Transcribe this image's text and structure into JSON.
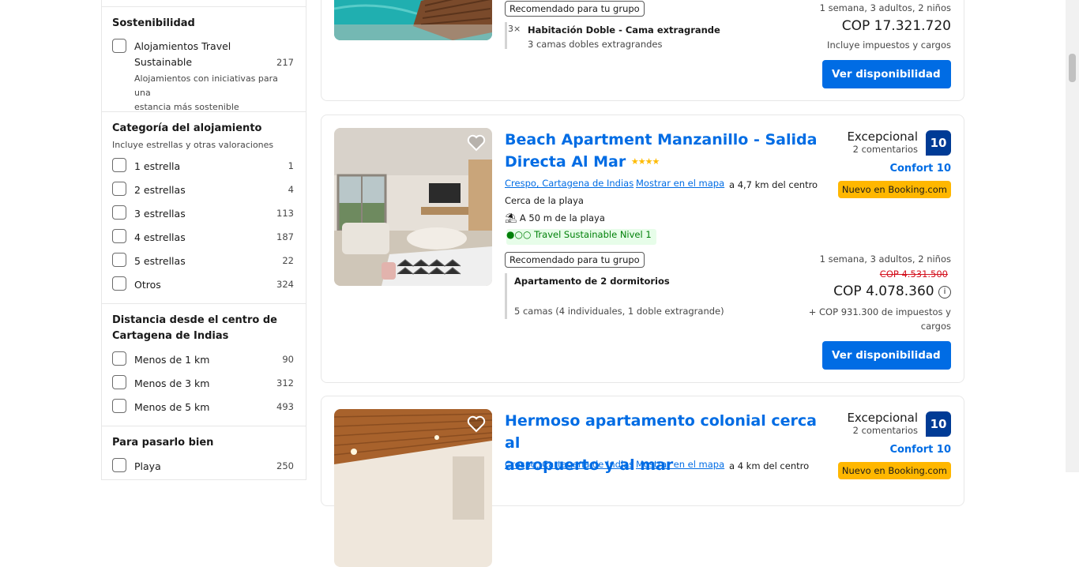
{
  "sidebar": {
    "sustainability": {
      "title": "Sostenibilidad",
      "items": [
        {
          "label_line1": "Alojamientos Travel",
          "label_line2": "Sustainable",
          "count": "217",
          "desc_line1": "Alojamientos con iniciativas para una",
          "desc_line2": "estancia más sostenible"
        }
      ]
    },
    "category": {
      "title": "Categoría del alojamiento",
      "subtitle": "Incluye estrellas y otras valoraciones",
      "items": [
        {
          "label": "1 estrella",
          "count": "1"
        },
        {
          "label": "2 estrellas",
          "count": "4"
        },
        {
          "label": "3 estrellas",
          "count": "113"
        },
        {
          "label": "4 estrellas",
          "count": "187"
        },
        {
          "label": "5 estrellas",
          "count": "22"
        },
        {
          "label": "Otros",
          "count": "324"
        }
      ]
    },
    "distance": {
      "title_line1": "Distancia desde el centro de",
      "title_line2": "Cartagena de Indias",
      "items": [
        {
          "label": "Menos de 1 km",
          "count": "90"
        },
        {
          "label": "Menos de 3 km",
          "count": "312"
        },
        {
          "label": "Menos de 5 km",
          "count": "493"
        }
      ]
    },
    "fun": {
      "title": "Para pasarlo bien",
      "items": [
        {
          "label": "Playa",
          "count": "250"
        }
      ]
    }
  },
  "cards": [
    {
      "recommended": "Recomendado para tu grupo",
      "room_qty": "3×",
      "room_title": "Habitación Doble - Cama extragrande",
      "room_desc": "3 camas dobles extragrandes",
      "stay": "1 semana, 3 adultos, 2 niños",
      "price": "COP 17.321.720",
      "taxes": "Incluye impuestos y cargos",
      "button": "Ver disponibilidad"
    },
    {
      "title_line1": "Beach Apartment Manzanillo - Salida",
      "title_line2": "Directa Al Mar",
      "stars": "★★★★",
      "location": "Crespo, Cartagena de Indias",
      "map_link": "Mostrar en el mapa",
      "distance": "a 4,7 km del centro",
      "near": "Cerca de la playa",
      "beach": "A 50 m de la playa",
      "sustainable": "Travel Sustainable Nivel 1",
      "recommended": "Recomendado para tu grupo",
      "room_title": "Apartamento de 2 dormitorios",
      "room_desc": "5 camas (4 individuales, 1 doble extragrande)",
      "score_word": "Excepcional",
      "reviews": "2 comentarios",
      "score": "10",
      "comfort": "Confort 10",
      "new_badge": "Nuevo en Booking.com",
      "stay": "1 semana, 3 adultos, 2 niños",
      "old_price": "COP 4.531.500",
      "price": "COP 4.078.360",
      "taxes_line1": "+ COP 931.300 de impuestos y",
      "taxes_line2": "cargos",
      "button": "Ver disponibilidad"
    },
    {
      "title_line1": "Hermoso apartamento colonial cerca al",
      "title_line2": "aeropuerto y al mar",
      "location": "Crespo, Cartagena de Indias",
      "map_link": "Mostrar en el mapa",
      "distance": "a 4 km del centro",
      "score_word": "Excepcional",
      "reviews": "2 comentarios",
      "score": "10",
      "comfort": "Confort 10",
      "new_badge": "Nuevo en Booking.com"
    }
  ],
  "colors": {
    "link": "#006ce4",
    "badge": "#003b95",
    "new": "#ffb700",
    "eco": "#008009"
  }
}
